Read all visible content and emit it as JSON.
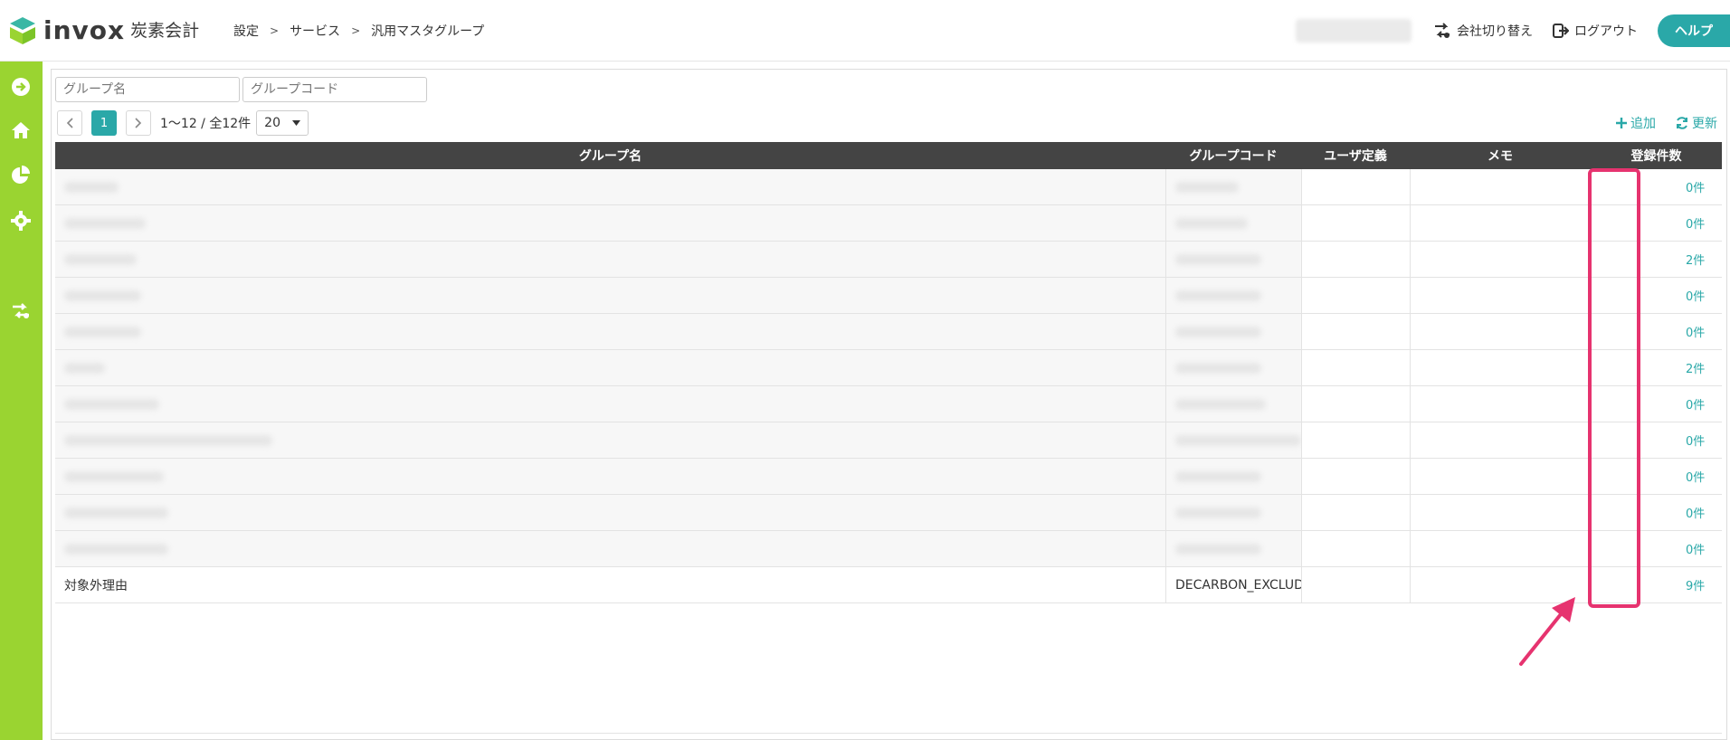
{
  "header": {
    "logo_text": "invox",
    "logo_sub": "炭素会計",
    "breadcrumb": [
      "設定",
      "サービス",
      "汎用マスタグループ"
    ],
    "switch_company": "会社切り替え",
    "logout": "ログアウト",
    "help": "ヘルプ"
  },
  "sidebar": {
    "items": [
      "arrow-right-circle-icon",
      "home-icon",
      "pie-chart-icon",
      "gear-icon",
      "switch-icon"
    ]
  },
  "filters": {
    "group_name_placeholder": "グループ名",
    "group_code_placeholder": "グループコード"
  },
  "pager": {
    "current_page": "1",
    "info": "1〜12 / 全12件",
    "per_page": "20"
  },
  "tools": {
    "add": "追加",
    "refresh": "更新"
  },
  "table": {
    "headers": [
      "グループ名",
      "グループコード",
      "ユーザ定義",
      "メモ",
      "登録件数"
    ],
    "rows": [
      {
        "name": "",
        "code": "",
        "count": "0件"
      },
      {
        "name": "",
        "code": "",
        "count": "0件"
      },
      {
        "name": "",
        "code": "",
        "count": "2件"
      },
      {
        "name": "",
        "code": "",
        "count": "0件"
      },
      {
        "name": "",
        "code": "",
        "count": "0件"
      },
      {
        "name": "",
        "code": "",
        "count": "2件"
      },
      {
        "name": "",
        "code": "",
        "count": "0件"
      },
      {
        "name": "",
        "code": "",
        "count": "0件"
      },
      {
        "name": "",
        "code": "",
        "count": "0件"
      },
      {
        "name": "",
        "code": "",
        "count": "0件"
      },
      {
        "name": "",
        "code": "",
        "count": "0件"
      },
      {
        "name": "対象外理由",
        "code": "DECARBON_EXCLUDE_",
        "count": "9件"
      }
    ]
  },
  "colors": {
    "accent": "#2aa8a8",
    "sidebar": "#9ad431",
    "header_row": "#444444",
    "highlight": "#e6336f"
  }
}
